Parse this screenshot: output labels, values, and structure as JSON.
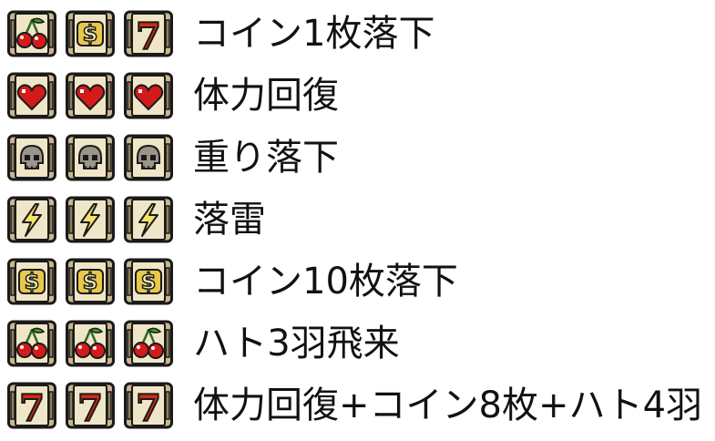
{
  "rows": [
    {
      "symbols": [
        "cherry",
        "dollar",
        "seven"
      ],
      "label": "コイン1枚落下"
    },
    {
      "symbols": [
        "heart",
        "heart",
        "heart"
      ],
      "label": "体力回復"
    },
    {
      "symbols": [
        "skull",
        "skull",
        "skull"
      ],
      "label": "重り落下"
    },
    {
      "symbols": [
        "lightning",
        "lightning",
        "lightning"
      ],
      "label": "落雷"
    },
    {
      "symbols": [
        "dollar",
        "dollar",
        "dollar"
      ],
      "label": "コイン10枚落下"
    },
    {
      "symbols": [
        "cherry",
        "cherry",
        "cherry"
      ],
      "label": "ハト3羽飛来"
    },
    {
      "symbols": [
        "seven",
        "seven",
        "seven"
      ],
      "label": "体力回復+コイン8枚+ハト4羽"
    }
  ],
  "colors": {
    "reel_frame": "#c9b78f",
    "reel_bg": "#efe6c8",
    "outline": "#1a1a1a",
    "cherry": "#d41a1a",
    "heart": "#d41a1a",
    "seven": "#d42a12",
    "gold": "#e8c84a",
    "skull": "#9a948a",
    "lightning": "#f4e26a"
  }
}
